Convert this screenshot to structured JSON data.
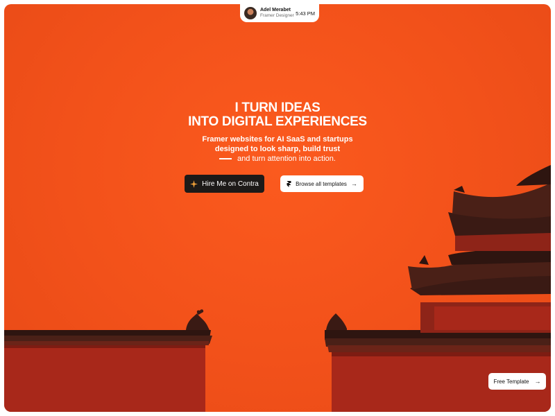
{
  "profile": {
    "name": "Adel Merabet",
    "role": "Framer Designer",
    "time": "5:43 PM"
  },
  "hero": {
    "title_line1": "I TURN IDEAS",
    "title_line2": "INTO DIGITAL EXPERIENCES",
    "sub_line1": "Framer websites for AI SaaS and startups",
    "sub_line2": "designed to look sharp, build trust",
    "sub_line3": "and turn attention into action."
  },
  "buttons": {
    "hire_label": "Hire Me on Contra",
    "browse_label": "Browse all templates",
    "free_label": "Free Template",
    "arrow": "→"
  },
  "colors": {
    "background": "#f2511a",
    "wall": "#a8281a",
    "roof": "#3a1a14",
    "dark_button": "#1d1a18"
  },
  "icons": {
    "hire": "contra-star-icon",
    "browse": "framer-icon",
    "arrow": "arrow-right-icon"
  }
}
